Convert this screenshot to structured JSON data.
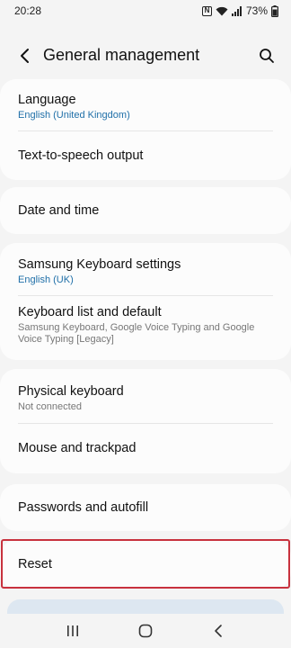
{
  "status_bar": {
    "time": "20:28",
    "battery": "73%",
    "icons": [
      "nfc-icon",
      "wifi-icon",
      "signal-icon",
      "battery-icon"
    ]
  },
  "header": {
    "title": "General management",
    "back_icon": "back-arrow-icon",
    "search_icon": "search-icon"
  },
  "groups": [
    {
      "items": [
        {
          "title": "Language",
          "subtitle": "English (United Kingdom)",
          "subtitle_style": "blue"
        },
        {
          "title": "Text-to-speech output",
          "subtitle": null
        }
      ]
    },
    {
      "items": [
        {
          "title": "Date and time",
          "subtitle": null
        }
      ]
    },
    {
      "items": [
        {
          "title": "Samsung Keyboard settings",
          "subtitle": "English (UK)",
          "subtitle_style": "blue"
        },
        {
          "title": "Keyboard list and default",
          "subtitle": "Samsung Keyboard, Google Voice Typing and Google Voice Typing [Legacy]",
          "subtitle_style": "grey"
        }
      ]
    },
    {
      "items": [
        {
          "title": "Physical keyboard",
          "subtitle": "Not connected",
          "subtitle_style": "grey"
        },
        {
          "title": "Mouse and trackpad",
          "subtitle": null
        }
      ]
    },
    {
      "items": [
        {
          "title": "Passwords and autofill",
          "subtitle": null
        }
      ]
    },
    {
      "items": [
        {
          "title": "Reset",
          "subtitle": null
        }
      ]
    }
  ],
  "nav_bar": {
    "icons": [
      "recent-apps-icon",
      "home-icon",
      "back-icon"
    ]
  },
  "colors": {
    "background": "#f4f4f4",
    "card": "#fcfcfc",
    "accent_blue": "#1f6fa8",
    "highlight_red": "#c8323e"
  }
}
